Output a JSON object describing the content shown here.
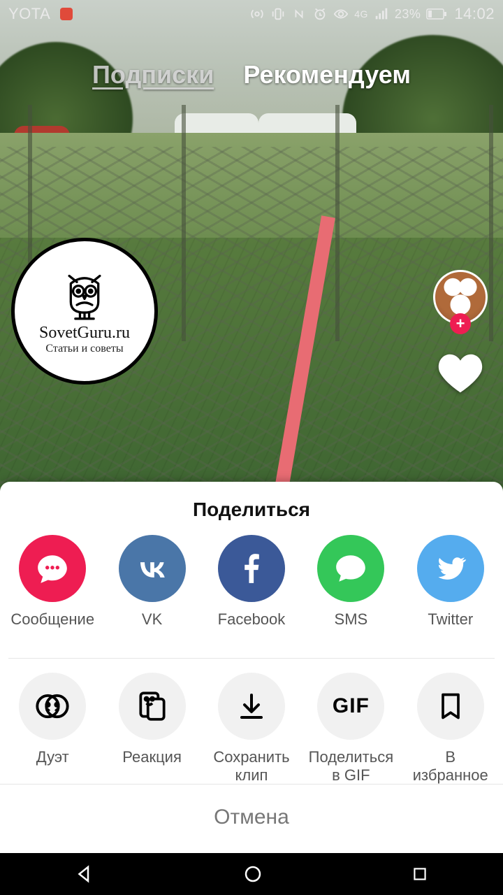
{
  "statusbar": {
    "carrier": "YOTA",
    "network_label": "4G",
    "battery_percent": "23%",
    "time": "14:02"
  },
  "feed_tabs": {
    "following": "Подписки",
    "for_you": "Рекомендуем"
  },
  "watermark": {
    "brand": "SovetGuru.ru",
    "subtitle": "Статьи и советы"
  },
  "sheet": {
    "title": "Поделиться",
    "cancel": "Отмена",
    "social": [
      {
        "label": "Сообщение"
      },
      {
        "label": "VK"
      },
      {
        "label": "Facebook"
      },
      {
        "label": "SMS"
      },
      {
        "label": "Twitter"
      }
    ],
    "actions": [
      {
        "label": "Дуэт"
      },
      {
        "label": "Реакция"
      },
      {
        "label": "Сохранить\nклип"
      },
      {
        "label": "Поделиться\nв GIF"
      },
      {
        "label": "В\nизбранное"
      }
    ],
    "gif_text": "GIF"
  },
  "colors": {
    "accent": "#ee1d52",
    "vk": "#4a76a8",
    "fb": "#3b5998",
    "sms": "#34c759",
    "twitter": "#55acee",
    "arrow": "#e86c73"
  }
}
